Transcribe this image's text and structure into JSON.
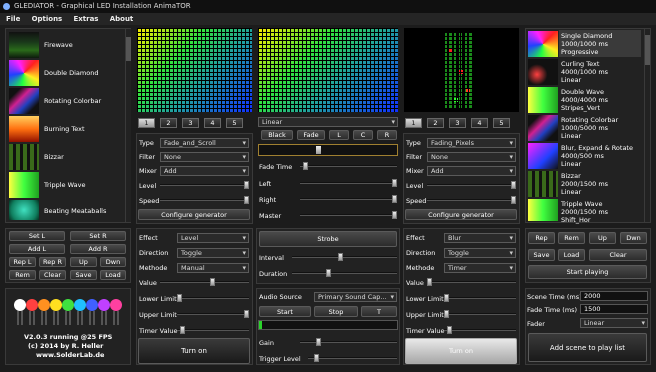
{
  "window": {
    "title": "GLEDIATOR - Graphical LED Installation AnimaTOR"
  },
  "menu": [
    "File",
    "Options",
    "Extras",
    "About"
  ],
  "left_list": {
    "items": [
      "Firewave",
      "Double Diamond",
      "Rotating Colorbar",
      "Burning Text",
      "Bizzar",
      "Tripple Wave",
      "Beating Meataballs"
    ]
  },
  "left_buttons": {
    "set_l": "Set L",
    "set_r": "Set R",
    "add_l": "Add L",
    "add_r": "Add R",
    "rep_l": "Rep L",
    "rep_r": "Rep R",
    "up": "Up",
    "dwn": "Dwn",
    "rem": "Rem",
    "clear": "Clear",
    "save": "Save",
    "load": "Load"
  },
  "about": {
    "line1": "V2.0.3 running @25 FPS",
    "line2": "(c) 2014 by R. Heller",
    "line3": "www.SolderLab.de"
  },
  "tabs": [
    "1",
    "2",
    "3",
    "4",
    "5"
  ],
  "gen_left": {
    "type_label": "Type",
    "type_value": "Fade_and_Scroll",
    "filter_label": "Filter",
    "filter_value": "None",
    "mixer_label": "Mixer",
    "mixer_value": "Add",
    "level_label": "Level",
    "speed_label": "Speed",
    "configure": "Configure generator"
  },
  "gen_right": {
    "type_label": "Type",
    "type_value": "Fading_Pixels",
    "filter_label": "Filter",
    "filter_value": "None",
    "mixer_label": "Mixer",
    "mixer_value": "Add",
    "level_label": "Level",
    "speed_label": "Speed",
    "configure": "Configure generator"
  },
  "mixer": {
    "mode_value": "Linear",
    "btn_black": "Black",
    "btn_fade": "Fade",
    "btn_l": "L",
    "btn_c": "C",
    "btn_r": "R",
    "fade_time": "Fade Time",
    "left": "Left",
    "right": "Right",
    "master": "Master"
  },
  "fx_left": {
    "effect_label": "Effect",
    "effect_value": "Level",
    "direction_label": "Direction",
    "direction_value": "Toggle",
    "methode_label": "Methode",
    "methode_value": "Manual",
    "value_label": "Value",
    "lower_label": "Lower Limit",
    "upper_label": "Upper Limit",
    "timer_label": "Timer Value",
    "turn_on": "Turn on"
  },
  "fx_right": {
    "effect_label": "Effect",
    "effect_value": "Blur",
    "direction_label": "Direction",
    "direction_value": "Toggle",
    "methode_label": "Methode",
    "methode_value": "Timer",
    "value_label": "Value",
    "lower_label": "Lower Limit",
    "upper_label": "Upper Limit",
    "timer_label": "Timer Value",
    "turn_on": "Turn on"
  },
  "strobe": {
    "title": "Strobe",
    "interval": "Interval",
    "duration": "Duration"
  },
  "audio": {
    "source_label": "Audio Source",
    "source_value": "Primary Sound Cap...",
    "start": "Start",
    "stop": "Stop",
    "t": "T",
    "gain": "Gain",
    "trigger": "Trigger Level"
  },
  "playlist": {
    "items": [
      [
        "Single Diamond",
        "1000/1000 ms",
        "Progressive"
      ],
      [
        "Curling Text",
        "4000/1000 ms",
        "Linear"
      ],
      [
        "Double Wave",
        "4000/4000 ms",
        "Stripes_Vert"
      ],
      [
        "Rotating Colorbar",
        "1000/5000 ms",
        "Linear"
      ],
      [
        "Blur, Expand & Rotate",
        "4000/500 ms",
        "Linear"
      ],
      [
        "Bizzar",
        "2000/1500 ms",
        "Linear"
      ],
      [
        "Tripple Wave",
        "2000/1500 ms",
        "Shift_Hor"
      ]
    ]
  },
  "play_buttons": {
    "rep": "Rep",
    "rem": "Rem",
    "up": "Up",
    "dwn": "Dwn",
    "save": "Save",
    "load": "Load",
    "clear": "Clear",
    "start": "Start playing"
  },
  "scene": {
    "scene_time_label": "Scene Time (ms)",
    "scene_time_value": "2000",
    "fade_time_label": "Fade Time (ms)",
    "fade_time_value": "1500",
    "fader_label": "Fader",
    "fader_value": "Linear",
    "add": "Add scene to play list"
  },
  "colors": {
    "accent_grid_green": "#2bd42b",
    "panel_bg": "#222222"
  }
}
